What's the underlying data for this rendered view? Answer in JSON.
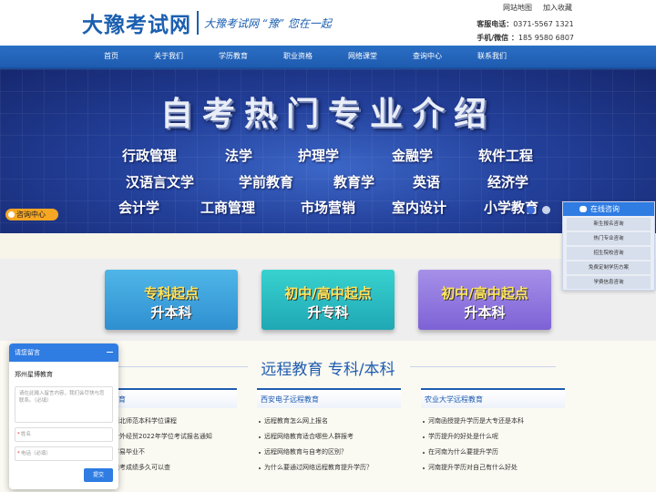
{
  "header": {
    "logo_main": "大豫考试网",
    "logo_slogan": "大豫考试网 “豫” 您在一起",
    "top_links": [
      "网站地图",
      "加入收藏"
    ],
    "service_label": "客服电话：",
    "service_phone": "0371-5567 1321",
    "mobile_label": "手机/微信 ：",
    "mobile_phone": "185 9580 6807"
  },
  "nav": [
    "首页",
    "关于我们",
    "学历教育",
    "职业资格",
    "网络课堂",
    "查询中心",
    "联系我们"
  ],
  "banner": {
    "title": "自考热门专业介绍",
    "majors": [
      "行政管理",
      "法学",
      "护理学",
      "金融学",
      "软件工程",
      "汉语言文学",
      "学前教育",
      "教育学",
      "英语",
      "经济学",
      "会计学",
      "工商管理",
      "市场营销",
      "室内设计",
      "小学教育"
    ],
    "consult_label": "咨询中心"
  },
  "cards": [
    {
      "line1": "专科起点",
      "line2": "升本科"
    },
    {
      "line1": "初中/高中起点",
      "line2": "升专科"
    },
    {
      "line1": "初中/高中起点",
      "line2": "升本科"
    }
  ],
  "section": {
    "title": "远程教育 专科/本科",
    "columns": [
      {
        "head": "远程教育",
        "items": [
          "教育西北师范本科学位课程",
          "教育对外经贸2022年学位考试报名通知",
          "教育容易毕业不",
          "教育统考成绩多久可以查"
        ]
      },
      {
        "head": "西安电子远程教育",
        "items": [
          "远程教育怎么网上报名",
          "远程网络教育适合哪些人群报考",
          "远程网络教育与自考的区别？",
          "为什么要通过网络远程教育提升学历？"
        ]
      },
      {
        "head": "农业大学远程教育",
        "items": [
          "河南函授提升学历是大专还是本科",
          "学历提升的好处是什么呢",
          "在河南为什么要提升学历",
          "河南提升学历对自己有什么好处"
        ]
      }
    ]
  },
  "chat": {
    "header": "请您留言",
    "company": "郑州星博教育",
    "message_placeholder": "请在此输入留言内容，我们会尽快与您联系。（必填）",
    "name_placeholder": "姓名",
    "phone_placeholder": "电话（必填）",
    "submit": "提交"
  },
  "side_panel": {
    "header": "在线咨询",
    "items": [
      "新生报名咨询",
      "热门专业咨询",
      "招生院校咨询",
      "免费定制学历方案",
      "学费信息咨询"
    ]
  }
}
